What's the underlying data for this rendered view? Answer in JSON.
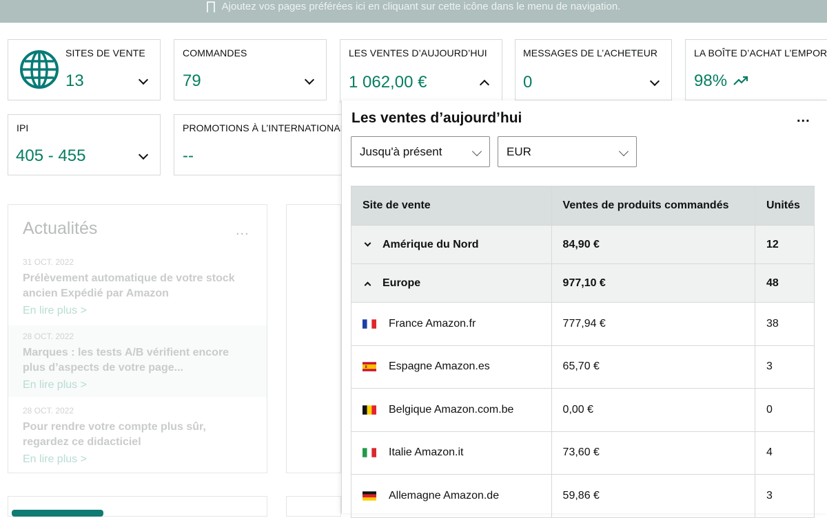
{
  "banner": {
    "text": "Ajoutez vos pages préférées ici en cliquant sur cette icône dans le menu de navigation."
  },
  "cards": {
    "sites": {
      "label": "SITES DE VENTE",
      "value": "13"
    },
    "orders": {
      "label": "COMMANDES",
      "value": "79"
    },
    "sales": {
      "label": "LES VENTES D’AUJOURD’HUI",
      "value": "1 062,00 €"
    },
    "messages": {
      "label": "MESSAGES DE L’ACHETEUR",
      "value": "0"
    },
    "buybox": {
      "label": "LA BOÎTE D’ACHAT L’EMPORTE",
      "value": "98%"
    },
    "ipi": {
      "label": "IPI",
      "value": "405 - 455"
    },
    "promos": {
      "label": "PROMOTIONS À L’INTERNATIONAL",
      "value": "--"
    }
  },
  "news": {
    "title": "Actualités",
    "menu": "...",
    "items": [
      {
        "date": "31 OCT. 2022",
        "headline": "Prélèvement automatique de votre stock ancien Expédié par Amazon",
        "more": "En lire plus >"
      },
      {
        "date": "28 OCT. 2022",
        "headline": "Marques : les tests A/B vérifient encore plus d’aspects de votre page...",
        "more": "En lire plus >"
      },
      {
        "date": "28 OCT. 2022",
        "headline": "Pour rendre votre compte plus sûr, regardez ce didacticiel",
        "more": "En lire plus >"
      }
    ]
  },
  "panel": {
    "title": "Les ventes d’aujourd’hui",
    "menu": "...",
    "period_select": "Jusqu'à présent",
    "currency_select": "EUR",
    "columns": [
      "Site de vente",
      "Ventes de produits commandés",
      "Unités"
    ],
    "groups": [
      {
        "name": "Amérique du Nord",
        "sales": "84,90 €",
        "units": "12"
      },
      {
        "name": "Europe",
        "sales": "977,10 €",
        "units": "48"
      }
    ],
    "rows": [
      {
        "site": "France Amazon.fr",
        "sales": "777,94 €",
        "units": "38"
      },
      {
        "site": "Espagne Amazon.es",
        "sales": "65,70 €",
        "units": "3"
      },
      {
        "site": "Belgique Amazon.com.be",
        "sales": "0,00 €",
        "units": "0"
      },
      {
        "site": "Italie Amazon.it",
        "sales": "73,60 €",
        "units": "4"
      },
      {
        "site": "Allemagne Amazon.de",
        "sales": "59,86 €",
        "units": "3"
      }
    ]
  },
  "colors": {
    "accent": "#067d62",
    "header_bg": "#d9dede",
    "group_bg": "#f0f2f2",
    "banner_bg": "#aebfbd"
  },
  "icons": [
    "bookmark-icon",
    "globe-icon",
    "chevron-down-icon",
    "chevron-up-icon",
    "trend-up-icon",
    "more-icon"
  ]
}
